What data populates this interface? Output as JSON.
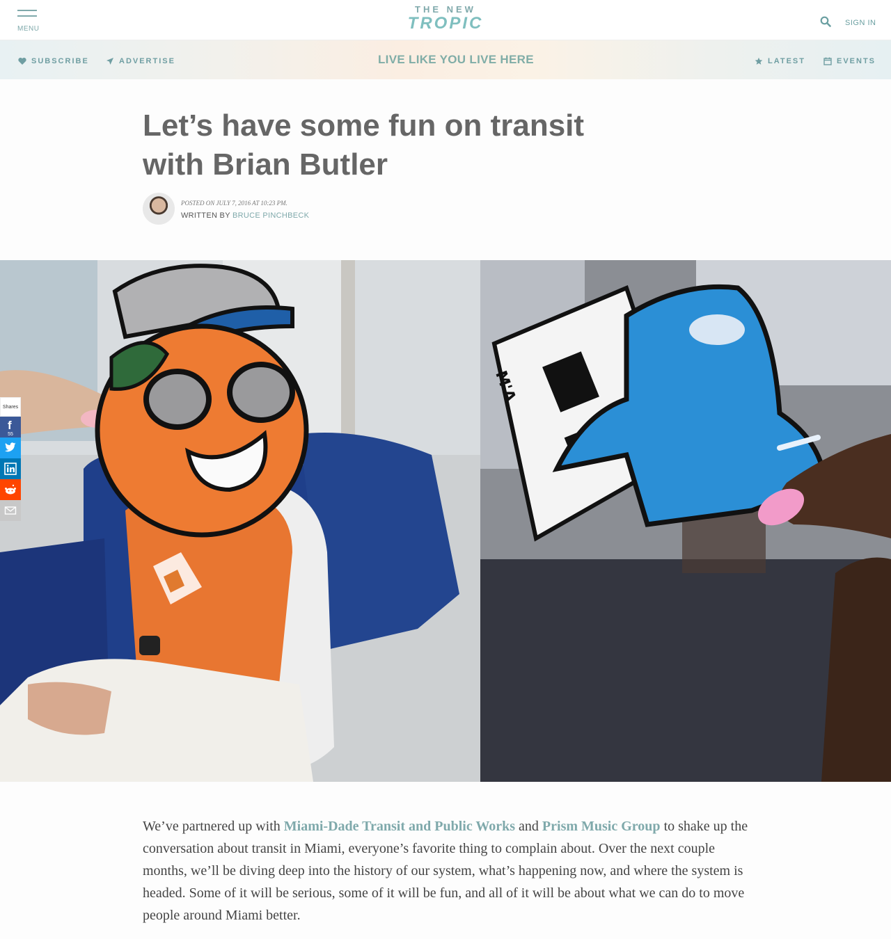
{
  "header": {
    "menu_label": "MENU",
    "logo_line1": "THE NEW",
    "logo_line2": "TROPIC",
    "signin_label": "SIGN IN"
  },
  "subnav": {
    "subscribe": "SUBSCRIBE",
    "advertise": "ADVERTISE",
    "tagline": "LIVE LIKE YOU LIVE HERE",
    "latest": "LATEST",
    "events": "EVENTS"
  },
  "article": {
    "title": "Let’s have some fun on transit with Brian Butler",
    "posted": "POSTED ON JULY 7, 2016 AT 10:23 PM.",
    "written_by": "WRITTEN BY",
    "author": "BRUCE PINCHBECK",
    "body_part1": "We’ve partnered up with ",
    "link1": "Miami-Dade Transit and Public Works",
    "body_part2": " and ",
    "link2": "Prism Music Group",
    "body_part3": " to shake up the conversation about transit in Miami, everyone’s favorite thing to complain about. Over the next couple months, we’ll be diving deep into the history of our system, what’s happening now, and where the system is headed. Some of it will be serious, some of it will be fun, and all of it will be about what we can do to move people around Miami better."
  },
  "share": {
    "label": "Shares",
    "facebook_count": "55",
    "colors": {
      "facebook": "#3b5998",
      "twitter": "#1da1f2",
      "linkedin": "#0077b5",
      "reddit": "#ff4500",
      "email": "#c8c8c8"
    }
  },
  "hero": {
    "illustration_text": "M'A"
  },
  "colors": {
    "accent": "#7fa9ab",
    "title": "#666666"
  }
}
